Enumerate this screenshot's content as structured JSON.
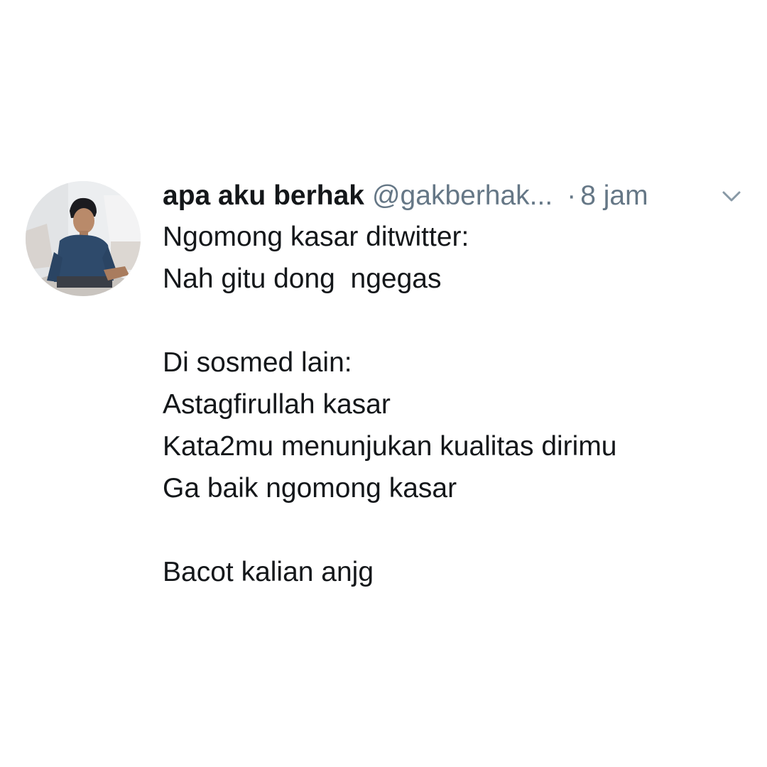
{
  "tweet": {
    "display_name": "apa aku berhak",
    "handle": "@gakberhak...",
    "separator": "·",
    "time": "8 jam",
    "lines": [
      "Ngomong kasar ditwitter:",
      "Nah gitu dong  ngegas",
      "",
      "Di sosmed lain:",
      "Astagfirullah kasar",
      "Kata2mu menunjukan kualitas dirimu",
      "Ga baik ngomong kasar",
      "",
      "Bacot kalian anjg"
    ]
  },
  "icons": {
    "avatar": "profile-photo",
    "menu": "chevron-down-icon"
  },
  "colors": {
    "text": "#14171a",
    "secondary": "#657786",
    "background": "#ffffff"
  }
}
